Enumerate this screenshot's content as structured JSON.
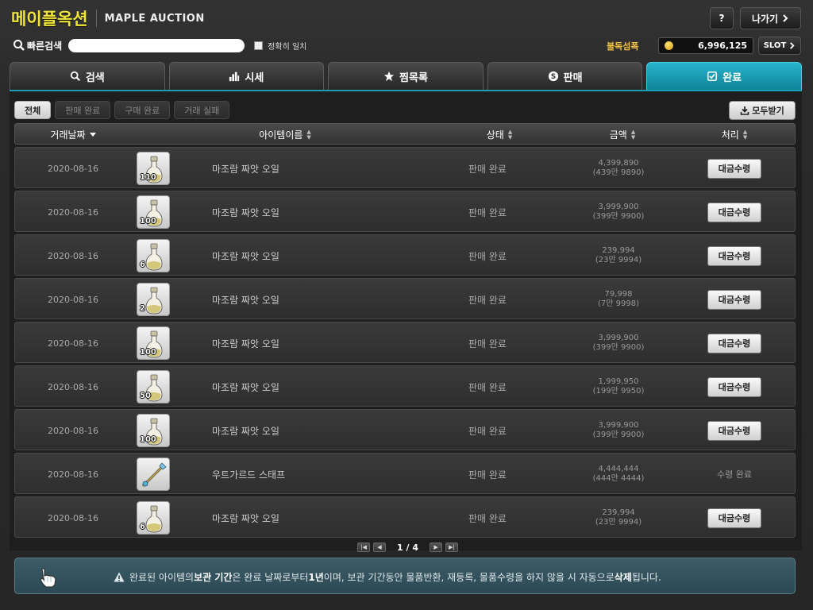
{
  "header": {
    "brand_ko": "메이플옥션",
    "brand_en": "MAPLE AUCTION",
    "help_label": "?",
    "exit_label": "나가기",
    "quick_search_label": "빠른검색",
    "quick_search_value": "",
    "exact_match_label": "정확히 일치",
    "user_name": "불독섬폭",
    "meso": "6,996,125",
    "slot_label": "SLOT"
  },
  "tabs": [
    {
      "label": "검색",
      "icon": "search-icon"
    },
    {
      "label": "시세",
      "icon": "bar-chart-icon"
    },
    {
      "label": "찜목록",
      "icon": "star-icon"
    },
    {
      "label": "판매",
      "icon": "sell-icon"
    },
    {
      "label": "완료",
      "icon": "check-box-icon",
      "active": true
    }
  ],
  "filters": [
    {
      "label": "전체",
      "active": true
    },
    {
      "label": "판매 완료"
    },
    {
      "label": "구매 완료"
    },
    {
      "label": "거래 실패"
    }
  ],
  "receive_all_label": "모두받기",
  "columns": {
    "date": "거래날짜",
    "name": "아이템이름",
    "status": "상태",
    "price": "금액",
    "process": "처리"
  },
  "rows": [
    {
      "date": "2020-08-16",
      "qty": "110",
      "item": "potion",
      "name": "마조람 짜앗 오일",
      "status": "판매 완료",
      "price": "4,399,890",
      "price_sub": "(439만 9890)",
      "action": "대금수령"
    },
    {
      "date": "2020-08-16",
      "qty": "100",
      "item": "potion",
      "name": "마조람 짜앗 오일",
      "status": "판매 완료",
      "price": "3,999,900",
      "price_sub": "(399만 9900)",
      "action": "대금수령"
    },
    {
      "date": "2020-08-16",
      "qty": "6",
      "item": "potion",
      "name": "마조람 짜앗 오일",
      "status": "판매 완료",
      "price": "239,994",
      "price_sub": "(23만 9994)",
      "action": "대금수령"
    },
    {
      "date": "2020-08-16",
      "qty": "2",
      "item": "potion",
      "name": "마조람 짜앗 오일",
      "status": "판매 완료",
      "price": "79,998",
      "price_sub": "(7만 9998)",
      "action": "대금수령"
    },
    {
      "date": "2020-08-16",
      "qty": "100",
      "item": "potion",
      "name": "마조람 짜앗 오일",
      "status": "판매 완료",
      "price": "3,999,900",
      "price_sub": "(399만 9900)",
      "action": "대금수령"
    },
    {
      "date": "2020-08-16",
      "qty": "50",
      "item": "potion",
      "name": "마조람 짜앗 오일",
      "status": "판매 완료",
      "price": "1,999,950",
      "price_sub": "(199만 9950)",
      "action": "대금수령"
    },
    {
      "date": "2020-08-16",
      "qty": "100",
      "item": "potion",
      "name": "마조람 짜앗 오일",
      "status": "판매 완료",
      "price": "3,999,900",
      "price_sub": "(399만 9900)",
      "action": "대금수령"
    },
    {
      "date": "2020-08-16",
      "qty": "",
      "item": "staff",
      "name": "우트가르드 스태프",
      "status": "판매 완료",
      "price": "4,444,444",
      "price_sub": "(444만 4444)",
      "done_text": "수령 완료"
    },
    {
      "date": "2020-08-16",
      "qty": "6",
      "item": "potion",
      "name": "마조람 짜앗 오일",
      "status": "판매 완료",
      "price": "239,994",
      "price_sub": "(23만 9994)",
      "action": "대금수령"
    }
  ],
  "pagination": {
    "current": "1",
    "separator": "/",
    "total": "4"
  },
  "notice": {
    "p1": "완료된 아이템의 ",
    "b1": "보관 기간",
    "p2": "은 완료 날짜로부터 ",
    "b2": "1년",
    "p3": "이며, 보관 기간동안 물품반환, 재등록, 물품수령을 하지 않을 시 자동으로 ",
    "b3": "삭제",
    "p4": "됩니다."
  },
  "colors": {
    "accent": "#1a9fb6",
    "brand": "#f0e63a",
    "user": "#f0c040"
  }
}
